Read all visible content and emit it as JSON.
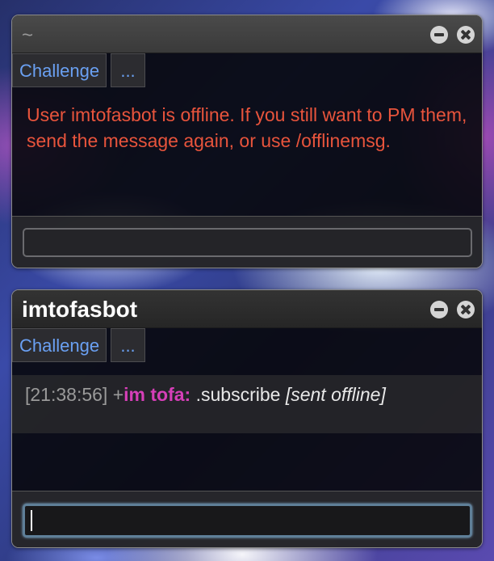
{
  "window1": {
    "title": "~",
    "tabs": [
      "Challenge",
      "..."
    ],
    "error_message": "User imtofasbot is offline. If you still want to PM them, send the message again, or use /offlinemsg.",
    "input_value": ""
  },
  "window2": {
    "title": "imtofasbot",
    "tabs": [
      "Challenge",
      "..."
    ],
    "message": {
      "timestamp": "[21:38:56]",
      "rank": "+",
      "sender": "im tofa:",
      "text": ".subscribe",
      "note": "[sent offline]"
    },
    "input_value": ""
  },
  "colors": {
    "tab_text": "#6aa0f2",
    "error_text": "#e8543c",
    "sender_name": "#d63fb8"
  },
  "icons": [
    "minimize-icon",
    "close-icon"
  ]
}
